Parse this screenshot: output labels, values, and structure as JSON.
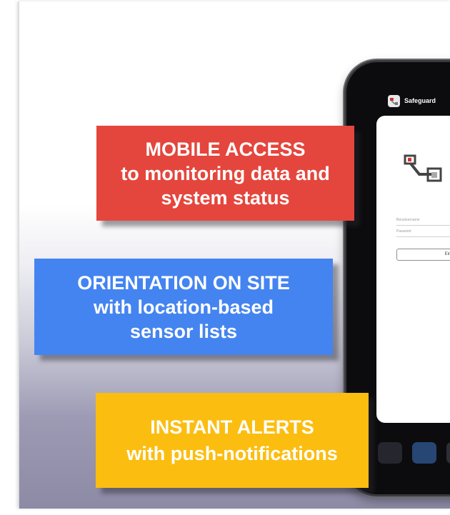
{
  "phone": {
    "app_title": "Safeguard",
    "username_placeholder": "Benutzername",
    "password_placeholder": "Passwort",
    "login_label": "Einlog"
  },
  "features": [
    {
      "heading": "MOBILE ACCESS",
      "line2": "to monitoring data and",
      "line3": "system status",
      "color": "#e4463d"
    },
    {
      "heading": "ORIENTATION ON SITE",
      "line2": "with location-based",
      "line3": "sensor lists",
      "color": "#4484f0"
    },
    {
      "heading": "INSTANT ALERTS",
      "line2": "with push-notifications",
      "color": "#fbbd10"
    }
  ]
}
